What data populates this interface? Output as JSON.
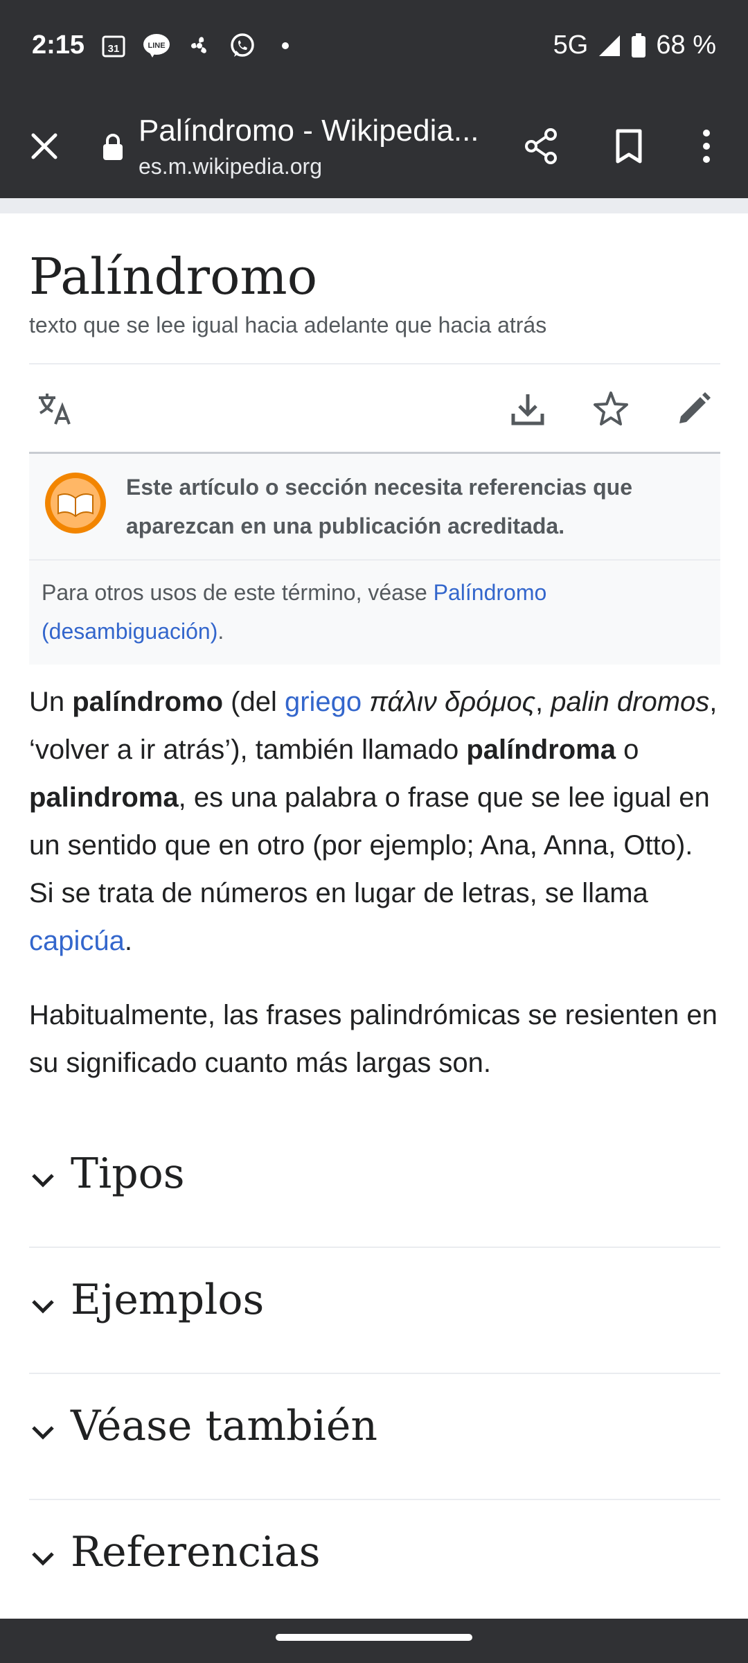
{
  "status_bar": {
    "time": "2:15",
    "network": "5G",
    "battery": "68 %",
    "left_icons": [
      "calendar-icon",
      "line-icon",
      "fan-icon",
      "whatsapp-icon",
      "dot-icon"
    ],
    "calendar_day": "31",
    "line_label": "LINE"
  },
  "toolbar": {
    "title": "Palíndromo - Wikipedia...",
    "url": "es.m.wikipedia.org"
  },
  "article": {
    "title": "Palíndromo",
    "description": "texto que se lee igual hacia adelante que hacia atrás",
    "notice_text": "Este artículo o sección necesita referencias que aparezcan en una publicación acreditada.",
    "hatnote_prefix": "Para otros usos de este término, véase ",
    "hatnote_link": "Palíndromo (desambiguación)",
    "hatnote_suffix": ".",
    "p1": {
      "t1": "Un ",
      "b1": "palíndromo",
      "t2": " (del ",
      "link1": "griego",
      "t3": " ",
      "i1": "πάλιν δρόμος",
      "t4": ", ",
      "i2": "palin dromos",
      "t5": ", ‘volver a ir atrás’), también llamado ",
      "b2": "palíndroma",
      "t6": " o ",
      "b3": "palindroma",
      "t7": ", es una palabra o frase que se lee igual en un sentido que en otro (por ejemplo; Ana, Anna, Otto). Si se trata de números en lugar de letras, se llama ",
      "link2": "capicúa",
      "t8": "."
    },
    "p2": "Habitualmente, las frases palindrómicas se resienten en su significado cuanto más largas son.",
    "sections": [
      "Tipos",
      "Ejemplos",
      "Véase también",
      "Referencias"
    ]
  },
  "colors": {
    "chrome": "#303134",
    "link": "#3366cc",
    "text": "#202122",
    "muted": "#54595d"
  }
}
